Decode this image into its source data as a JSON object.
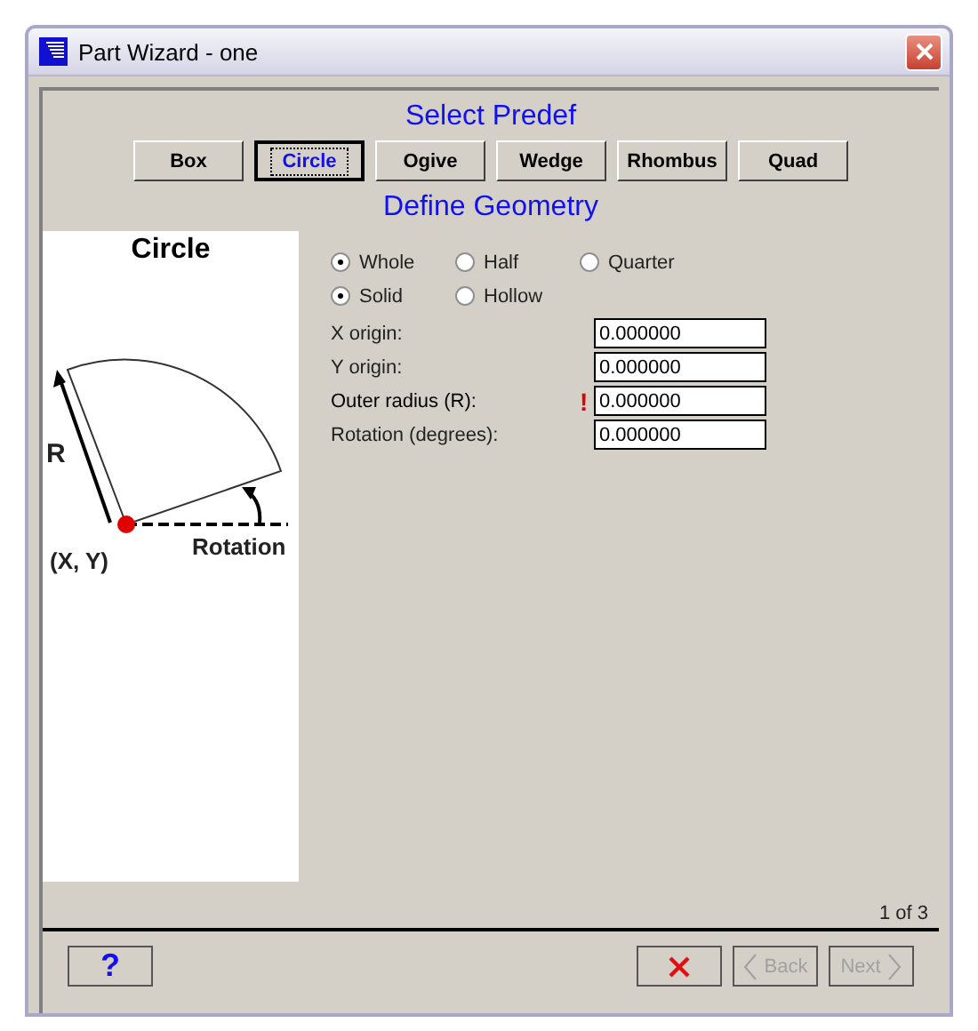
{
  "window": {
    "title": "Part Wizard - one"
  },
  "predef": {
    "title": "Select Predef",
    "shapes": [
      {
        "label": "Box",
        "selected": false
      },
      {
        "label": "Circle",
        "selected": true
      },
      {
        "label": "Ogive",
        "selected": false
      },
      {
        "label": "Wedge",
        "selected": false
      },
      {
        "label": "Rhombus",
        "selected": false
      },
      {
        "label": "Quad",
        "selected": false
      }
    ]
  },
  "geometry": {
    "title": "Define Geometry",
    "preview": {
      "title": "Circle",
      "radius_label": "R",
      "origin_label": "(X, Y)",
      "rotation_label": "Rotation"
    },
    "radio_groups": [
      [
        {
          "label": "Whole",
          "selected": true
        },
        {
          "label": "Half",
          "selected": false
        },
        {
          "label": "Quarter",
          "selected": false
        }
      ],
      [
        {
          "label": "Solid",
          "selected": true
        },
        {
          "label": "Hollow",
          "selected": false
        }
      ]
    ],
    "fields": [
      {
        "label": "X origin:",
        "value": "0.000000",
        "warning": false
      },
      {
        "label": "Y origin:",
        "value": "0.000000",
        "warning": false
      },
      {
        "label": "Outer radius (R):",
        "value": "0.000000",
        "warning": true,
        "warning_mark": "!"
      },
      {
        "label": "Rotation (degrees):",
        "value": "0.000000",
        "warning": false
      }
    ]
  },
  "status": {
    "page": "1 of 3"
  },
  "buttons": [
    {
      "kind": "help",
      "label": "?",
      "disabled": false
    },
    {
      "kind": "cancel"
    },
    {
      "kind": "back",
      "label": "Back",
      "disabled": true
    },
    {
      "kind": "next",
      "label": "Next",
      "disabled": true
    }
  ]
}
